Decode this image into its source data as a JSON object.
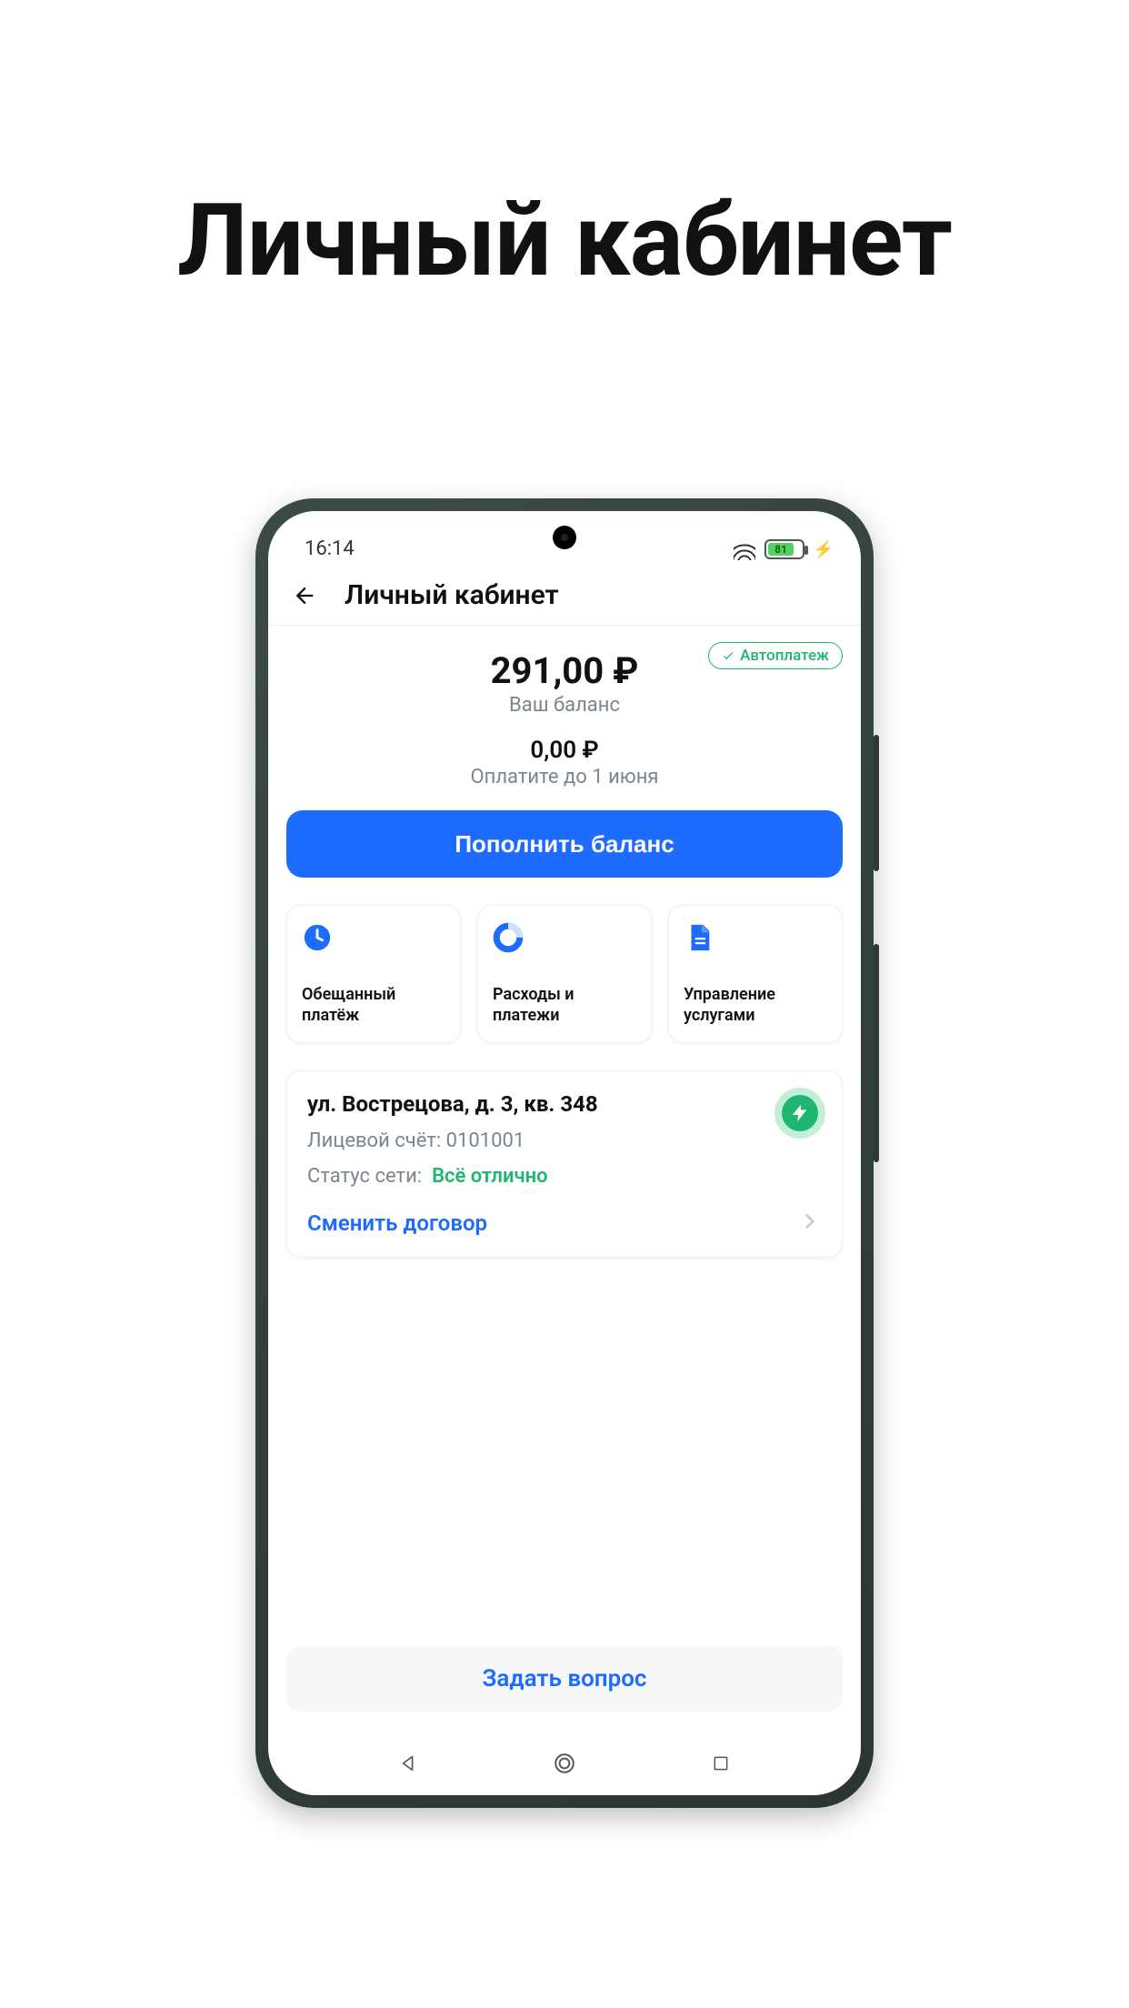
{
  "hero_title": "Личный кабинет",
  "status_bar": {
    "time": "16:14",
    "battery_pct": "81"
  },
  "header": {
    "title": "Личный кабинет"
  },
  "balance": {
    "amount": "291,00 ₽",
    "label": "Ваш баланс"
  },
  "due": {
    "amount": "0,00 ₽",
    "label": "Оплатите до 1 июня"
  },
  "autopay_badge": "Автоплатеж",
  "primary_button": "Пополнить баланс",
  "tiles": [
    {
      "label": "Обещанный платёж",
      "icon": "clock-icon"
    },
    {
      "label": "Расходы и платежи",
      "icon": "donut-chart-icon"
    },
    {
      "label": "Управление услугами",
      "icon": "document-icon"
    }
  ],
  "account": {
    "address": "ул. Вострецова, д. 3, кв. 348",
    "account_label": "Лицевой счёт:",
    "account_number": "0101001",
    "status_label": "Статус сети:",
    "status_value": "Всё отлично",
    "change_label": "Сменить договор"
  },
  "ask_button": "Задать вопрос"
}
